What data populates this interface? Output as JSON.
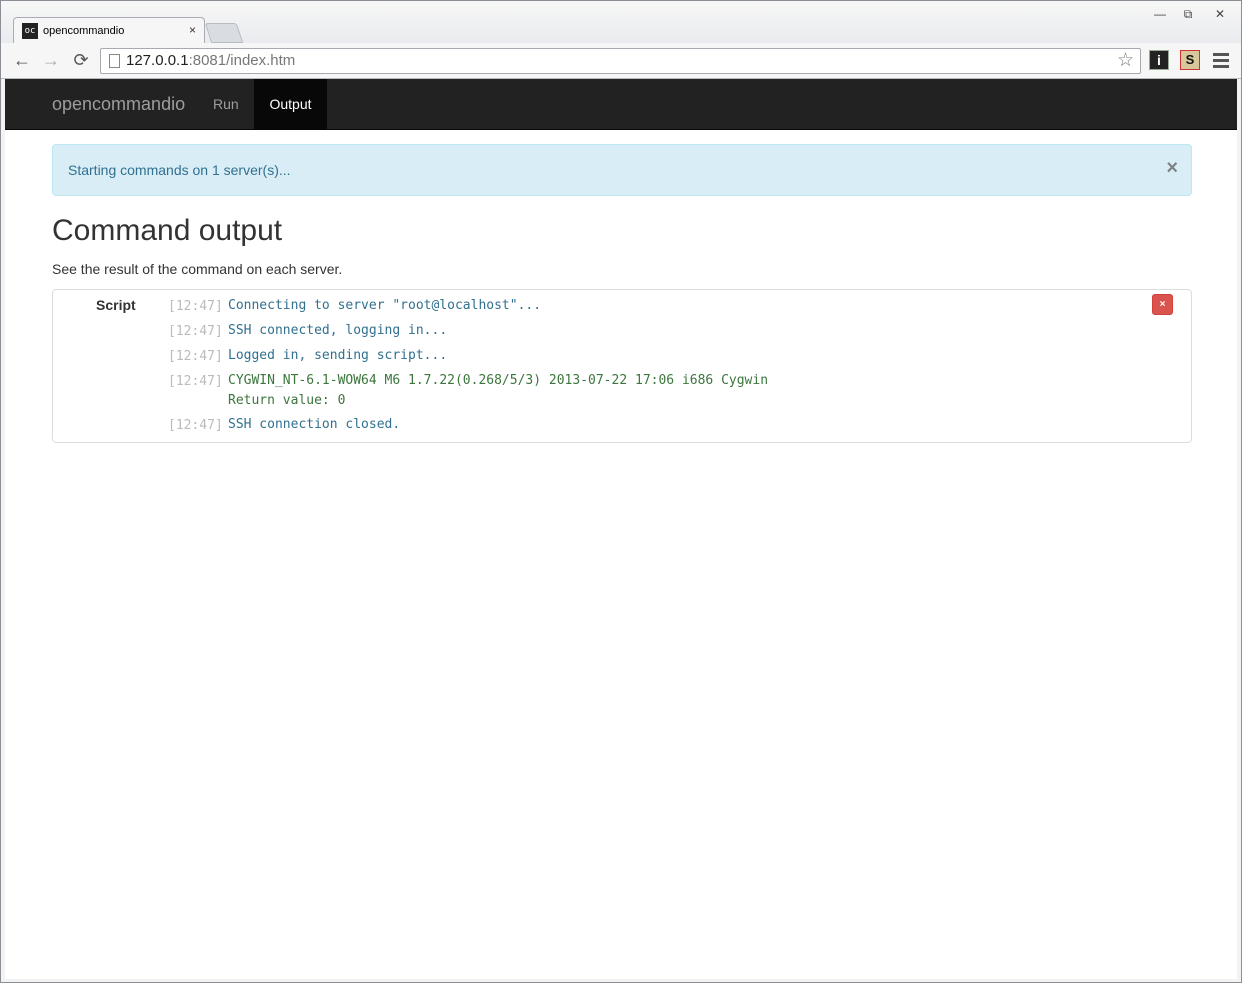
{
  "browser": {
    "tab_favicon": "oc",
    "tab_title": "opencommandio",
    "tab_close": "×",
    "window_controls": {
      "minimize": "—",
      "restore": "⧉",
      "close": "✕"
    },
    "back_icon": "←",
    "forward_icon": "→",
    "reload_icon": "⟳",
    "url_host": "127.0.0.1",
    "url_rest": ":8081/index.htm",
    "star_icon": "☆",
    "ext1": "i",
    "ext2": "S"
  },
  "navbar": {
    "brand": "opencommandio",
    "items": [
      {
        "label": "Run",
        "active": false
      },
      {
        "label": "Output",
        "active": true
      }
    ]
  },
  "alert": {
    "message": "Starting commands on 1 server(s)...",
    "close": "×"
  },
  "page": {
    "title": "Command output",
    "subtitle": "See the result of the command on each server."
  },
  "output": {
    "label": "Script",
    "remove": "×",
    "lines": [
      {
        "time": "[12:47]",
        "text": "Connecting to server \"root@localhost\"...",
        "type": "info"
      },
      {
        "time": "[12:47]",
        "text": "SSH connected, logging in...",
        "type": "info"
      },
      {
        "time": "[12:47]",
        "text": "Logged in, sending script...",
        "type": "info"
      },
      {
        "time": "[12:47]",
        "text": "CYGWIN_NT-6.1-WOW64 M6 1.7.22(0.268/5/3) 2013-07-22 17:06 i686 Cygwin",
        "text2": "Return value: 0",
        "type": "result"
      },
      {
        "time": "[12:47]",
        "text": "SSH connection closed.",
        "type": "info"
      }
    ]
  }
}
